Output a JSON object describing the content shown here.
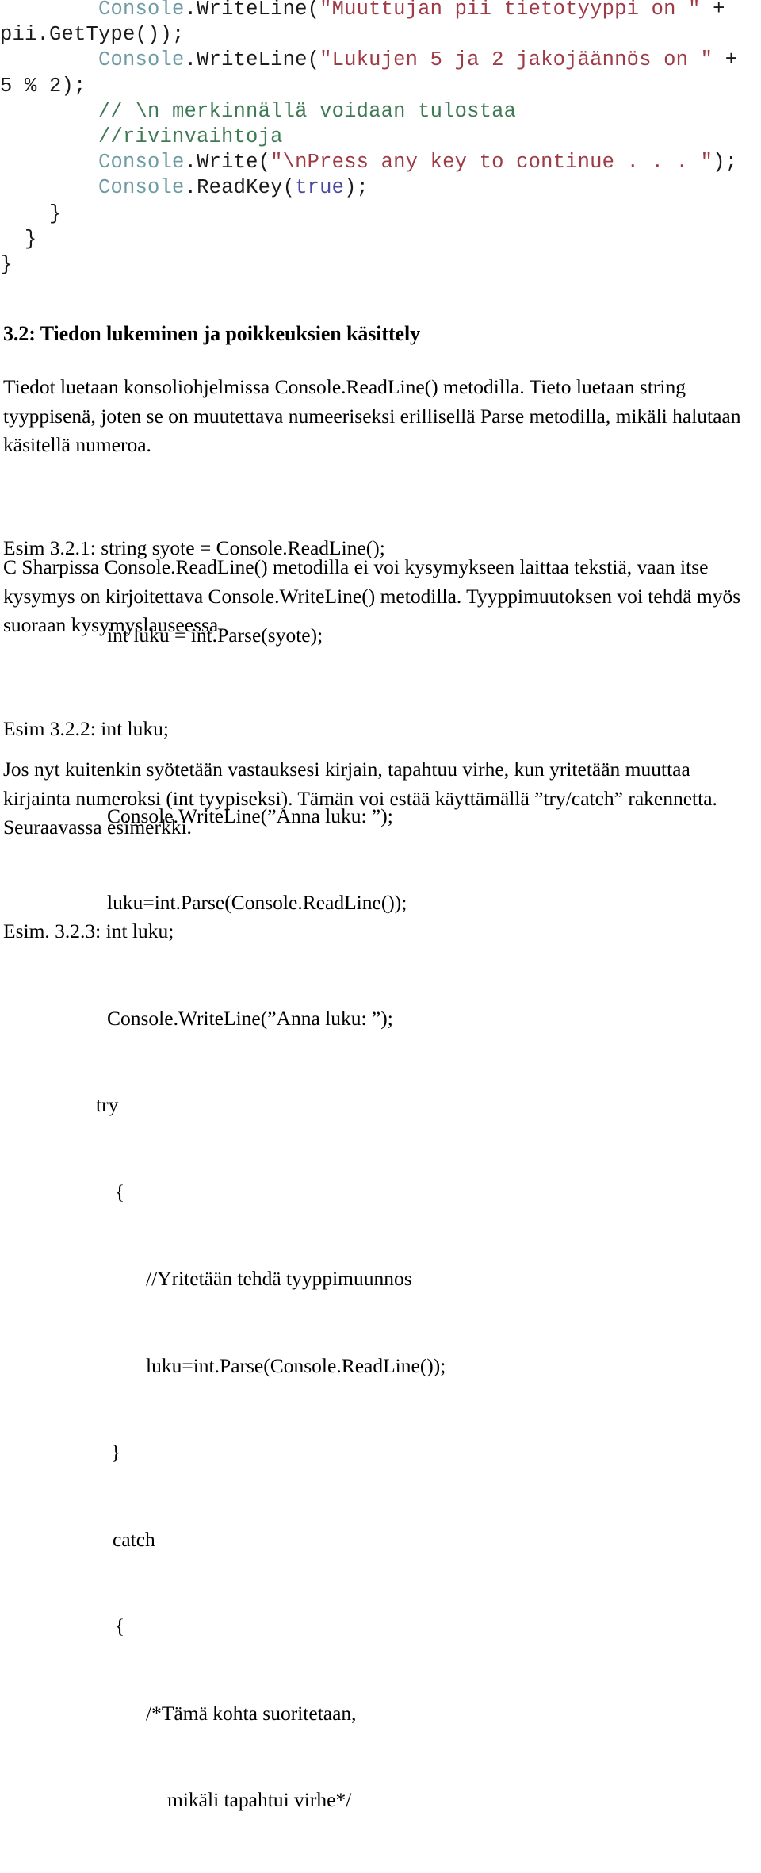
{
  "document": {
    "code_block": {
      "lines": [
        [
          {
            "t": "plain",
            "s": "        "
          },
          {
            "t": "type",
            "s": "Console"
          },
          {
            "t": "plain",
            "s": ".WriteLine("
          },
          {
            "t": "string",
            "s": "\"Muuttujan pii tietotyyppi on \""
          },
          {
            "t": "plain",
            "s": " + pii.GetType());"
          }
        ],
        [
          {
            "t": "plain",
            "s": "        "
          },
          {
            "t": "type",
            "s": "Console"
          },
          {
            "t": "plain",
            "s": ".WriteLine("
          },
          {
            "t": "string",
            "s": "\"Lukujen 5 ja 2 jakojäännös on \""
          },
          {
            "t": "plain",
            "s": " + 5 % 2);"
          }
        ],
        [
          {
            "t": "plain",
            "s": "        "
          },
          {
            "t": "comment",
            "s": "// \\n merkinnällä voidaan tulostaa"
          }
        ],
        [
          {
            "t": "plain",
            "s": "        "
          },
          {
            "t": "comment",
            "s": "//rivinvaihtoja"
          }
        ],
        [
          {
            "t": "plain",
            "s": "        "
          },
          {
            "t": "type",
            "s": "Console"
          },
          {
            "t": "plain",
            "s": ".Write("
          },
          {
            "t": "string",
            "s": "\"\\nPress any key to continue . . . \""
          },
          {
            "t": "plain",
            "s": ");"
          }
        ],
        [
          {
            "t": "plain",
            "s": "        "
          },
          {
            "t": "type",
            "s": "Console"
          },
          {
            "t": "plain",
            "s": ".ReadKey("
          },
          {
            "t": "kw",
            "s": "true"
          },
          {
            "t": "plain",
            "s": ");"
          }
        ],
        [
          {
            "t": "plain",
            "s": "    }"
          }
        ],
        [
          {
            "t": "plain",
            "s": "  }"
          }
        ],
        [
          {
            "t": "plain",
            "s": "}"
          }
        ]
      ]
    },
    "heading": "3.2: Tiedon lukeminen ja poikkeuksien käsittely",
    "paragraph_1": "Tiedot luetaan konsoliohjelmissa Console.ReadLine() metodilla. Tieto luetaan string tyyppisenä, joten se on muutettava numeeriseksi erillisellä Parse metodilla, mikäli halutaan käsitellä numeroa.",
    "example_1": {
      "line_1": "Esim 3.2.1: string syote = Console.ReadLine();",
      "line_2": "int luku = int.Parse(syote);"
    },
    "paragraph_2": "C Sharpissa Console.ReadLine() metodilla ei voi kysymykseen laittaa tekstiä, vaan itse kysymys on kirjoitettava Console.WriteLine() metodilla. Tyyppimuutoksen voi tehdä myös suoraan kysymyslauseessa.",
    "example_2": {
      "line_1": "Esim 3.2.2: int luku;",
      "line_2": "Console.WriteLine(”Anna luku: ”);",
      "line_3": "luku=int.Parse(Console.ReadLine());"
    },
    "paragraph_3": "Jos nyt kuitenkin syötetään vastauksesi kirjain, tapahtuu virhe, kun yritetään muuttaa kirjainta numeroksi (int tyypiseksi). Tämän voi estää käyttämällä ”try/catch” rakennetta. Seuraavassa esimerkki.",
    "example_3": {
      "line_1": "Esim. 3.2.3: int luku;",
      "line_2": "Console.WriteLine(”Anna luku: ”);",
      "line_3": "try",
      "line_4": "{",
      "line_5": "//Yritetään tehdä tyyppimuunnos",
      "line_6": "luku=int.Parse(Console.ReadLine());",
      "line_7": "}",
      "line_8": "catch",
      "line_9": "{",
      "line_10": "/*Tämä kohta suoritetaan,",
      "line_11": "mikäli tapahtui virhe*/"
    }
  },
  "colors": {
    "type": "#6f9ba4",
    "string": "#9e3b46",
    "comment": "#3f7a55",
    "keyword": "#4a4aa0",
    "text": "#000000",
    "background": "#ffffff"
  }
}
